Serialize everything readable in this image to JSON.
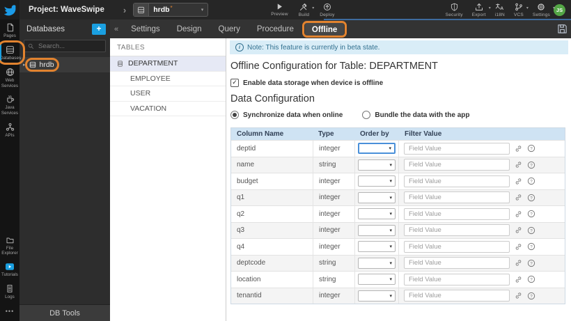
{
  "colors": {
    "accent_blue": "#1a9fe0",
    "annotation_orange": "#e2832f",
    "note_bg": "#d9edf7",
    "table_header_bg": "#cfe3f3",
    "avatar_green": "#54a646"
  },
  "topbar": {
    "project_label": "Project: WaveSwipe",
    "db_selector_value": "hrdb",
    "db_selector_modified": "*",
    "preview_label": "Preview",
    "build_label": "Build",
    "deploy_label": "Deploy",
    "security_label": "Security",
    "export_label": "Export",
    "i18n_label": "i18N",
    "vcs_label": "VCS",
    "settings_label": "Settings",
    "avatar_initials": "JS"
  },
  "sidebar": {
    "items": [
      {
        "label": "Pages",
        "active": false
      },
      {
        "label": "Databases",
        "active": true
      },
      {
        "label": "Web Services",
        "active": false
      },
      {
        "label": "Java Services",
        "active": false
      },
      {
        "label": "APIs",
        "active": false
      }
    ],
    "bottom_items": [
      {
        "label": "File Explorer"
      },
      {
        "label": "Tutorials"
      },
      {
        "label": "Logs"
      }
    ]
  },
  "db_panel": {
    "title": "Databases",
    "add_button": "+",
    "search_placeholder": "Search...",
    "db_name": "hrdb",
    "footer_button": "DB Tools"
  },
  "tabbar": {
    "tabs": [
      {
        "label": "Settings",
        "active": false
      },
      {
        "label": "Design",
        "active": false
      },
      {
        "label": "Query",
        "active": false
      },
      {
        "label": "Procedure",
        "active": false
      },
      {
        "label": "Offline",
        "active": true
      }
    ]
  },
  "tables_panel": {
    "title": "TABLES",
    "tables": [
      {
        "label": "DEPARTMENT",
        "selected": true
      },
      {
        "label": "EMPLOYEE",
        "selected": false
      },
      {
        "label": "USER",
        "selected": false
      },
      {
        "label": "VACATION",
        "selected": false
      }
    ]
  },
  "main": {
    "note_text": "Note: This feature is currently in beta state.",
    "page_title": "Offline Configuration for Table: DEPARTMENT",
    "enable_offline_label": "Enable data storage when device is offline",
    "enable_offline_checked": true,
    "section_title": "Data Configuration",
    "radio_sync_label": "Synchronize data when online",
    "radio_sync_selected": true,
    "radio_bundle_label": "Bundle the data with the app",
    "radio_bundle_selected": false,
    "table": {
      "headers": [
        "Column Name",
        "Type",
        "Order by",
        "Filter Value"
      ],
      "filter_placeholder": "Field Value",
      "order_by_value": "",
      "rows": [
        {
          "name": "deptid",
          "type": "integer"
        },
        {
          "name": "name",
          "type": "string"
        },
        {
          "name": "budget",
          "type": "integer"
        },
        {
          "name": "q1",
          "type": "integer"
        },
        {
          "name": "q2",
          "type": "integer"
        },
        {
          "name": "q3",
          "type": "integer"
        },
        {
          "name": "q4",
          "type": "integer"
        },
        {
          "name": "deptcode",
          "type": "string"
        },
        {
          "name": "location",
          "type": "string"
        },
        {
          "name": "tenantid",
          "type": "integer"
        }
      ]
    }
  }
}
